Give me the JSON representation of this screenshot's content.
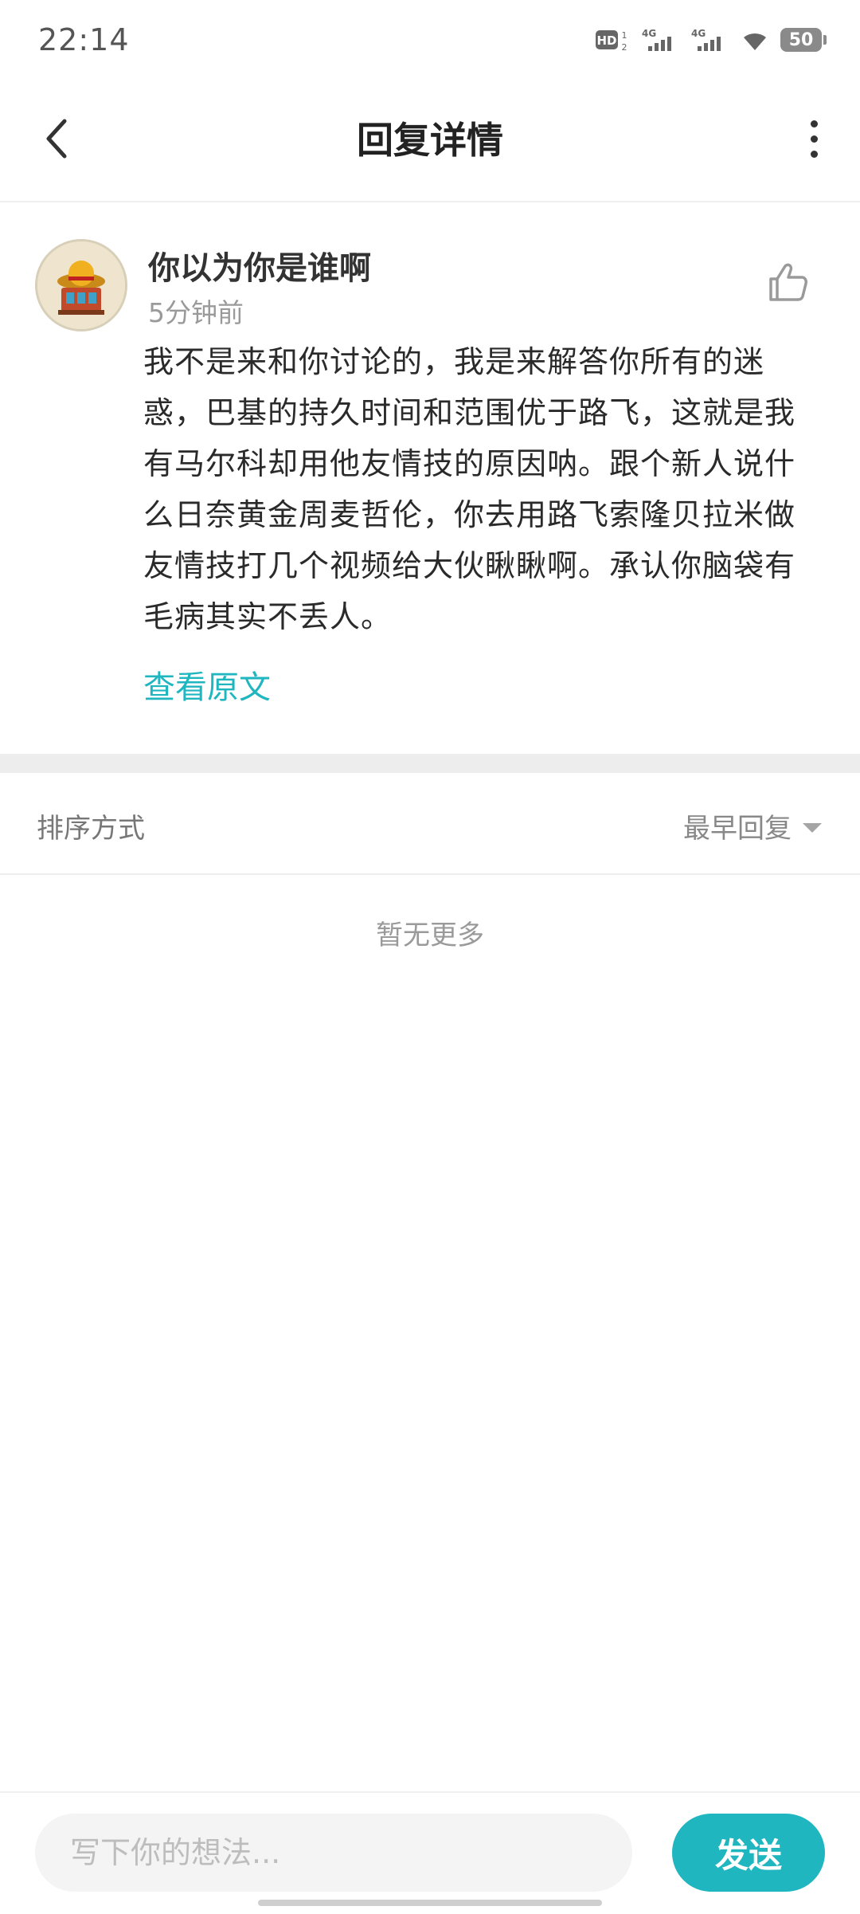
{
  "status_bar": {
    "time": "22:14",
    "battery": "50",
    "icons": [
      "hd-voice-icon",
      "4g-signal-icon",
      "4g-signal-icon",
      "wifi-icon",
      "battery-icon"
    ]
  },
  "header": {
    "title": "回复详情",
    "back_icon": "chevron-left-icon",
    "more_icon": "more-vertical-icon"
  },
  "reply": {
    "username": "你以为你是谁啊",
    "time_ago": "5分钟前",
    "content": "我不是来和你讨论的，我是来解答你所有的迷惑，巴基的持久时间和范围优于路飞，这就是我有马尔科却用他友情技的原因呐。跟个新人说什么日奈黄金周麦哲伦，你去用路飞索隆贝拉米做友情技打几个视频给大伙瞅瞅啊。承认你脑袋有毛病其实不丢人。",
    "view_original": "查看原文",
    "like_icon": "thumbs-up-icon"
  },
  "sort": {
    "label": "排序方式",
    "selected": "最早回复"
  },
  "empty_state": "暂无更多",
  "composer": {
    "placeholder": "写下你的想法...",
    "send_label": "发送"
  },
  "colors": {
    "accent": "#1fb6c0",
    "muted_text": "#9a9a9a"
  }
}
